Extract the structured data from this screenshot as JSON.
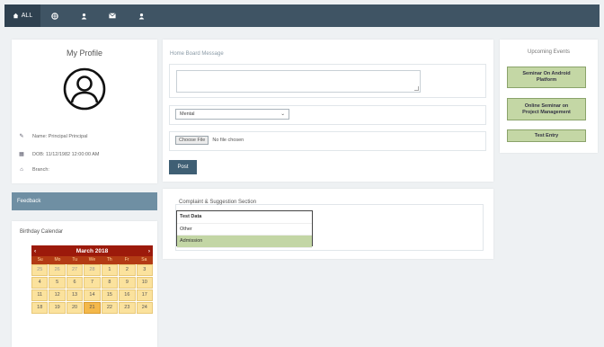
{
  "topbar": {
    "tabs": [
      {
        "label": "ALL",
        "icon": "home-icon",
        "active": true
      },
      {
        "icon": "globe-icon"
      },
      {
        "icon": "person-icon"
      },
      {
        "icon": "mail-icon"
      },
      {
        "icon": "person-icon"
      }
    ]
  },
  "profile": {
    "title": "My Profile",
    "avatar_icon": "user-circle-icon",
    "rows": [
      {
        "icon": "pencil-icon",
        "text": "Name: Principal Principal"
      },
      {
        "icon": "calendar-icon",
        "text": "DOB: 11/12/1982 12:00:00 AM"
      },
      {
        "icon": "branch-icon",
        "text": "Branch:"
      }
    ]
  },
  "feedback": {
    "label": "Feedback"
  },
  "birthday": {
    "title": "Birthday Calendar",
    "calendar": {
      "month_label": "March 2018",
      "prev": "‹",
      "next": "›",
      "dow": [
        "Su",
        "Mo",
        "Tu",
        "We",
        "Th",
        "Fr",
        "Sa"
      ],
      "weeks": [
        [
          "25",
          "26",
          "27",
          "28",
          "1",
          "2",
          "3"
        ],
        [
          "4",
          "5",
          "6",
          "7",
          "8",
          "9",
          "10"
        ],
        [
          "11",
          "12",
          "13",
          "14",
          "15",
          "16",
          "17"
        ],
        [
          "18",
          "19",
          "20",
          "21",
          "22",
          "23",
          "24"
        ]
      ],
      "today": "21"
    }
  },
  "homeboard": {
    "label": "Home Board Message",
    "textarea_value": "",
    "select_value": "Mental",
    "file_button": "Choose File",
    "file_status": "No file chosen",
    "post_button": "Post"
  },
  "complaint": {
    "label": "Complaint & Suggestion Section",
    "options": [
      "Test Data",
      "Other",
      "Admission"
    ],
    "selected": "Admission"
  },
  "upcoming": {
    "title": "Upcoming Events",
    "events": [
      {
        "label1": "Seminar On Android",
        "label2": "Platform"
      },
      {
        "label1": "Online Seminar on",
        "label2": "Project Management"
      },
      {
        "label1": "Test Entry",
        "label2": ""
      }
    ]
  },
  "colors": {
    "topbar": "#3f5464",
    "feedback_bar": "#6f8fa3",
    "calendar_header": "#9c1a0b",
    "calendar_cell": "#fbe29d",
    "event_button": "#c4d7a5"
  }
}
